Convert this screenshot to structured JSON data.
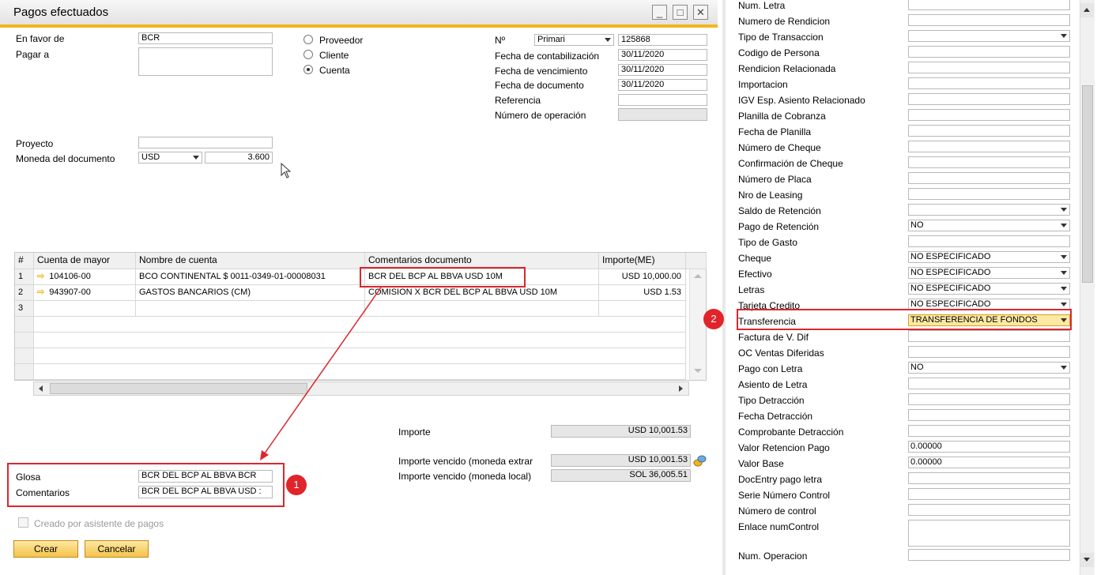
{
  "window": {
    "title": "Pagos efectuados"
  },
  "header": {
    "en_favor_de_label": "En favor de",
    "en_favor_de_value": "BCR",
    "pagar_a_label": "Pagar a",
    "pagar_a_value": "",
    "proyecto_label": "Proyecto",
    "proyecto_value": "",
    "moneda_label": "Moneda del documento",
    "moneda_value": "USD",
    "tipo_cambio": "3.600"
  },
  "radios": [
    {
      "label": "Proveedor",
      "selected": false
    },
    {
      "label": "Cliente",
      "selected": false
    },
    {
      "label": "Cuenta",
      "selected": true
    }
  ],
  "docinfo": {
    "no_label": "Nº",
    "serie": "Primari",
    "numero": "125868",
    "fecha_contab_label": "Fecha de contabilización",
    "fecha_contab": "30/11/2020",
    "fecha_venc_label": "Fecha de vencimiento",
    "fecha_venc": "30/11/2020",
    "fecha_doc_label": "Fecha de documento",
    "fecha_doc": "30/11/2020",
    "referencia_label": "Referencia",
    "referencia": "",
    "num_operacion_label": "Número de operación",
    "num_operacion": ""
  },
  "grid": {
    "headers": [
      "#",
      "Cuenta de mayor",
      "Nombre de cuenta",
      "Comentarios documento",
      "Importe(ME)"
    ],
    "rows": [
      {
        "n": "1",
        "cuenta": "104106-00",
        "nombre": "BCO CONTINENTAL $ 0011-0349-01-00008031",
        "comentario": "BCR DEL BCP AL BBVA USD 10M",
        "importe": "USD 10,000.00"
      },
      {
        "n": "2",
        "cuenta": "943907-00",
        "nombre": "GASTOS BANCARIOS (CM)",
        "comentario": "COMISION X BCR DEL BCP AL BBVA USD 10M",
        "importe": "USD 1.53"
      },
      {
        "n": "3",
        "cuenta": "",
        "nombre": "",
        "comentario": "",
        "importe": ""
      }
    ]
  },
  "totals": {
    "importe_label": "Importe",
    "importe": "USD 10,001.53",
    "vencido_ext_label": "Importe vencido (moneda extrar",
    "vencido_ext": "USD 10,001.53",
    "vencido_local_label": "Importe vencido (moneda local)",
    "vencido_local": "SOL 36,005.51"
  },
  "footer": {
    "glosa_label": "Glosa",
    "glosa": "BCR DEL BCP AL BBVA BCR",
    "comentarios_label": "Comentarios",
    "comentarios": "BCR DEL BCP AL BBVA USD :",
    "asistente_label": "Creado por asistente de pagos",
    "crear": "Crear",
    "cancelar": "Cancelar"
  },
  "callouts": {
    "one": "1",
    "two": "2"
  },
  "udf": [
    {
      "label": "Num. Letra",
      "value": ""
    },
    {
      "label": "Numero de Rendicion",
      "value": ""
    },
    {
      "label": "Tipo de Transaccion",
      "value": "",
      "combo": true
    },
    {
      "label": "Codigo de Persona",
      "value": ""
    },
    {
      "label": "Rendicion Relacionada",
      "value": ""
    },
    {
      "label": "Importacion",
      "value": ""
    },
    {
      "label": "IGV Esp. Asiento Relacionado",
      "value": ""
    },
    {
      "label": "Planilla de Cobranza",
      "value": ""
    },
    {
      "label": "Fecha de Planilla",
      "value": ""
    },
    {
      "label": "Número de Cheque",
      "value": ""
    },
    {
      "label": "Confirmación de Cheque",
      "value": ""
    },
    {
      "label": "Número de Placa",
      "value": ""
    },
    {
      "label": "Nro de Leasing",
      "value": ""
    },
    {
      "label": "Saldo de Retención",
      "value": "",
      "combo": true
    },
    {
      "label": "Pago de Retención",
      "value": "NO",
      "combo": true
    },
    {
      "label": "Tipo de Gasto",
      "value": ""
    },
    {
      "label": "Cheque",
      "value": "NO ESPECIFICADO",
      "combo": true
    },
    {
      "label": "Efectivo",
      "value": "NO ESPECIFICADO",
      "combo": true
    },
    {
      "label": "Letras",
      "value": "NO ESPECIFICADO",
      "combo": true
    },
    {
      "label": "Tarjeta Credito",
      "value": "NO ESPECIFICADO",
      "combo": true
    },
    {
      "label": "Transferencia",
      "value": "TRANSFERENCIA DE FONDOS",
      "combo": true,
      "highlight": true
    },
    {
      "label": "Factura de V. Dif",
      "value": ""
    },
    {
      "label": "OC Ventas Diferidas",
      "value": ""
    },
    {
      "label": "Pago con Letra",
      "value": "NO",
      "combo": true
    },
    {
      "label": "Asiento de Letra",
      "value": ""
    },
    {
      "label": "Tipo Detracción",
      "value": ""
    },
    {
      "label": "Fecha Detracción",
      "value": ""
    },
    {
      "label": "Comprobante Detracción",
      "value": ""
    },
    {
      "label": "Valor Retencion Pago",
      "value": "0.00000"
    },
    {
      "label": "Valor Base",
      "value": "0.00000"
    },
    {
      "label": "DocEntry pago letra",
      "value": ""
    },
    {
      "label": "Serie Número Control",
      "value": ""
    },
    {
      "label": "Número de control",
      "value": ""
    },
    {
      "label": "Enlace numControl",
      "value": "",
      "tall": true
    },
    {
      "label": "Num. Operacion",
      "value": ""
    }
  ]
}
